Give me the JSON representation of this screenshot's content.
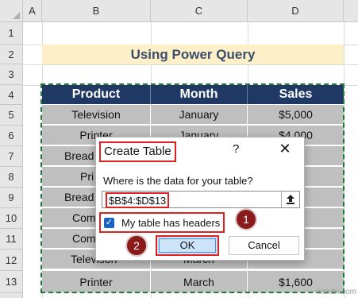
{
  "columns": [
    "A",
    "B",
    "C",
    "D"
  ],
  "rows": [
    "1",
    "2",
    "3",
    "4",
    "5",
    "6",
    "7",
    "8",
    "9",
    "10",
    "11",
    "12",
    "13"
  ],
  "title": "Using Power Query",
  "table": {
    "headers": [
      "Product",
      "Month",
      "Sales"
    ],
    "rows": [
      [
        "Television",
        "January",
        "$5,000"
      ],
      [
        "Printer",
        "January",
        "$4,000"
      ],
      [
        "Bread",
        "",
        ""
      ],
      [
        "Pri",
        "",
        ""
      ],
      [
        "Bread",
        "",
        ""
      ],
      [
        "Com",
        "",
        ""
      ],
      [
        "Com",
        "",
        ""
      ],
      [
        "Televison",
        "March",
        ""
      ],
      [
        "Printer",
        "March",
        "$1,600"
      ]
    ]
  },
  "dialog": {
    "title": "Create Table",
    "help": "?",
    "close": "✕",
    "question": "Where is the data for your table?",
    "range": "$B$4:$D$13",
    "checkbox_label": "My table has headers",
    "ok": "OK",
    "cancel": "Cancel"
  },
  "badges": {
    "one": "1",
    "two": "2"
  },
  "watermark": "wsxdn.com"
}
